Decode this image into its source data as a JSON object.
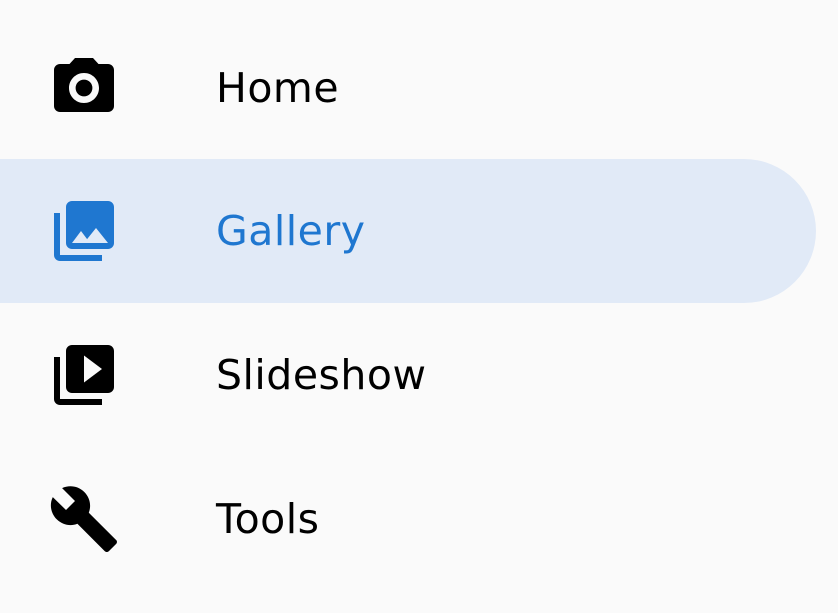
{
  "colors": {
    "background": "#fafafa",
    "selected_background": "#e1eaf7",
    "selected_foreground": "#1f77d0",
    "default_foreground": "#000000"
  },
  "drawer": {
    "items": [
      {
        "label": "Home",
        "icon": "camera-icon",
        "selected": false
      },
      {
        "label": "Gallery",
        "icon": "photo-library-icon",
        "selected": true
      },
      {
        "label": "Slideshow",
        "icon": "video-library-icon",
        "selected": false
      },
      {
        "label": "Tools",
        "icon": "wrench-icon",
        "selected": false
      }
    ]
  }
}
